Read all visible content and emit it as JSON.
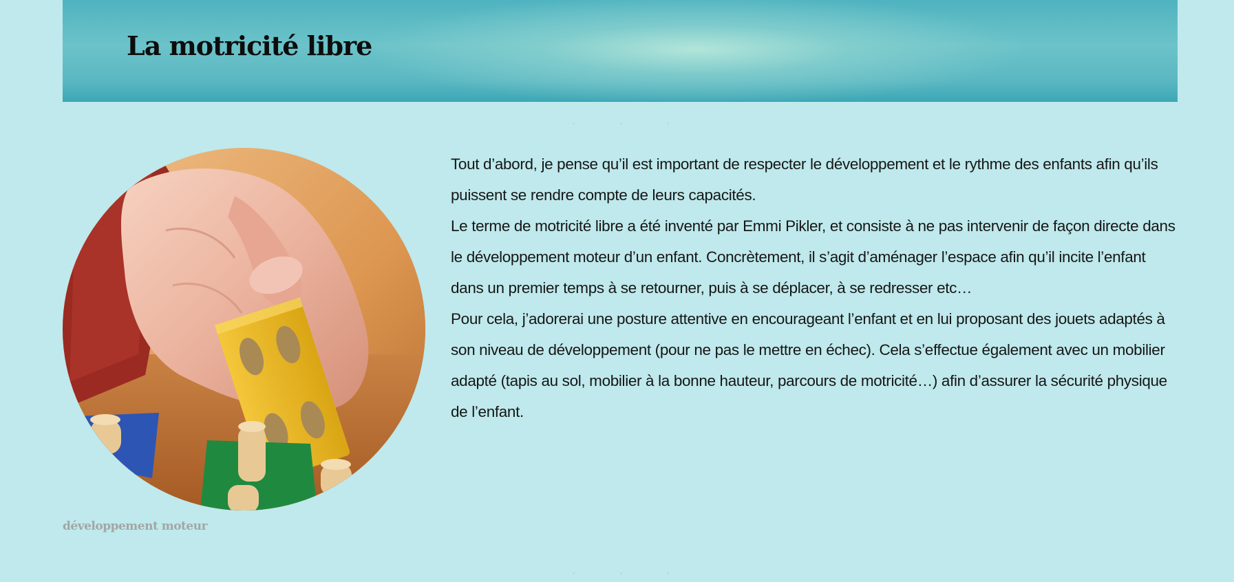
{
  "header": {
    "title": "La motricité libre"
  },
  "figure": {
    "image_icon": "hand-holding-wooden-block-image",
    "caption": "développement moteur"
  },
  "article": {
    "paragraphs": [
      "Tout d’abord, je pense qu’il est important de respecter le développement et le rythme des enfants afin qu’ils puissent se rendre compte de leurs capacités.",
      "Le terme de motricité libre a été inventé par Emmi Pikler, et consiste à ne pas intervenir de façon directe dans le développement moteur d’un enfant. Concrètement, il s’agit d’aménager l’espace afin qu’il incite l’enfant dans un premier temps à se retourner, puis à se déplacer, à se redresser etc…",
      "Pour cela, j’adorerai une posture attentive en encourageant l’enfant et en lui proposant des jouets adaptés à son niveau de développement (pour ne pas le mettre en échec). Cela s’effectue également avec un mobilier adapté (tapis au sol, mobilier à la bonne hauteur, parcours de motricité…) afin d’assurer la sécurité physique de l’enfant."
    ]
  },
  "colors": {
    "page_background": "#bfe9ec",
    "banner": "#5ab7c2",
    "caption_text": "#a2a6a5"
  }
}
